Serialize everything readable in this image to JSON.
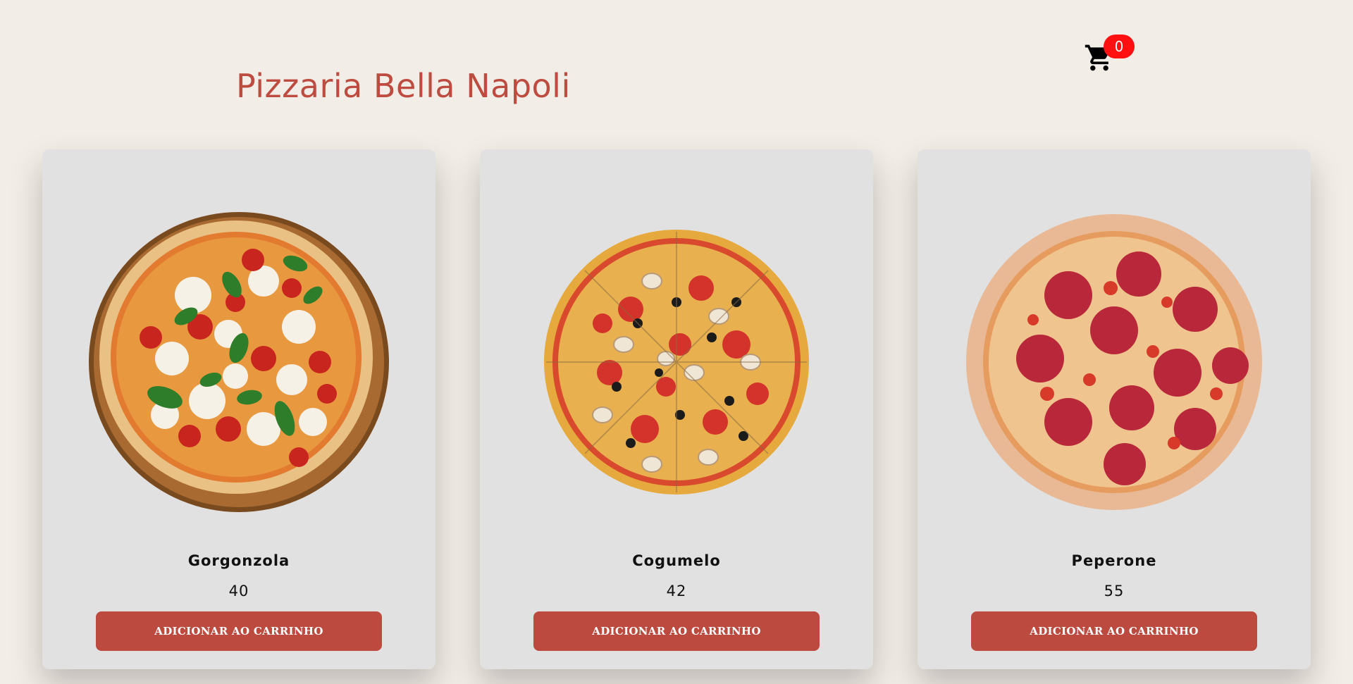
{
  "header": {
    "title": "Pizzaria Bella Napoli",
    "cart": {
      "icon": "shopping-cart-icon",
      "count": "0",
      "badge_color": "#ff1111"
    }
  },
  "products": [
    {
      "name": "Gorgonzola",
      "price": "40",
      "button_label": "ADICIONAR AO CARRINHO",
      "image": "margherita-pizza-on-wooden-board"
    },
    {
      "name": "Cogumelo",
      "price": "42",
      "button_label": "ADICIONAR AO CARRINHO",
      "image": "mushroom-olive-pepperoni-pizza"
    },
    {
      "name": "Peperone",
      "price": "55",
      "button_label": "ADICIONAR AO CARRINHO",
      "image": "pepperoni-pizza"
    }
  ],
  "colors": {
    "accent": "#bc4a3f",
    "title": "#bd4b40",
    "background": "#f3ede7",
    "card": "#e1e1e1"
  }
}
